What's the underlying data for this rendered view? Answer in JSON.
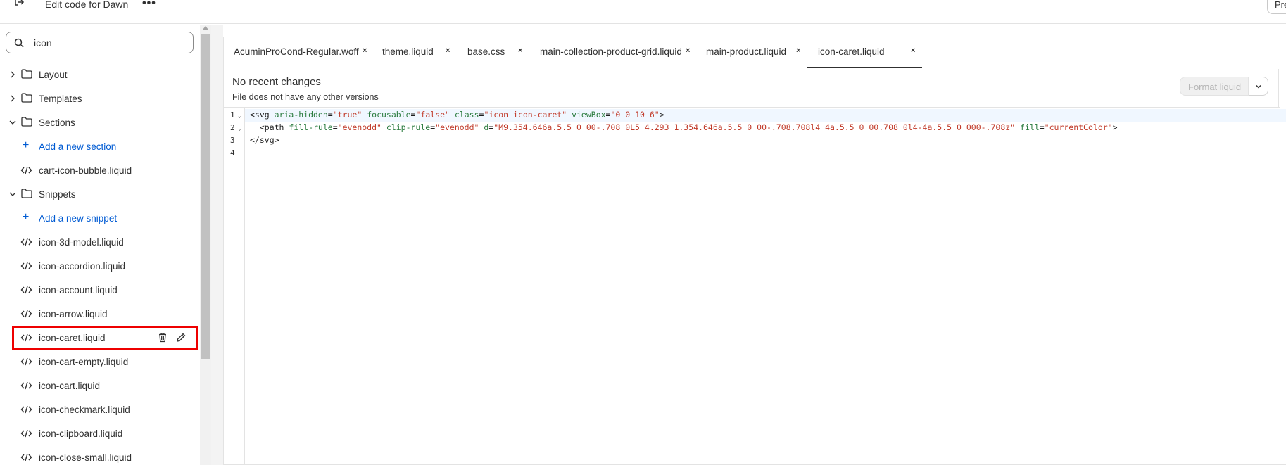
{
  "topbar": {
    "title": "Edit code for Dawn",
    "more_label": "•••",
    "preview_label": "Preview"
  },
  "sidebar": {
    "search_value": "icon",
    "items": [
      {
        "type": "folder",
        "label": "Layout",
        "expanded": false
      },
      {
        "type": "folder",
        "label": "Templates",
        "expanded": false
      },
      {
        "type": "folder",
        "label": "Sections",
        "expanded": true
      },
      {
        "type": "add",
        "label": "Add a new section"
      },
      {
        "type": "file",
        "label": "cart-icon-bubble.liquid"
      },
      {
        "type": "folder",
        "label": "Snippets",
        "expanded": true
      },
      {
        "type": "add",
        "label": "Add a new snippet"
      },
      {
        "type": "file",
        "label": "icon-3d-model.liquid"
      },
      {
        "type": "file",
        "label": "icon-accordion.liquid"
      },
      {
        "type": "file",
        "label": "icon-account.liquid"
      },
      {
        "type": "file",
        "label": "icon-arrow.liquid"
      },
      {
        "type": "file",
        "label": "icon-caret.liquid",
        "selected": true
      },
      {
        "type": "file",
        "label": "icon-cart-empty.liquid"
      },
      {
        "type": "file",
        "label": "icon-cart.liquid"
      },
      {
        "type": "file",
        "label": "icon-checkmark.liquid"
      },
      {
        "type": "file",
        "label": "icon-clipboard.liquid"
      },
      {
        "type": "file",
        "label": "icon-close-small.liquid"
      }
    ]
  },
  "tabs": [
    {
      "label": "AcuminProCond-Regular.woff",
      "close": "×"
    },
    {
      "label": "theme.liquid",
      "close": "×"
    },
    {
      "label": "base.css",
      "close": "×"
    },
    {
      "label": "main-collection-product-grid.liquid",
      "close": "×"
    },
    {
      "label": "main-product.liquid",
      "close": "×"
    },
    {
      "label": "icon-caret.liquid",
      "close": "×",
      "active": true
    }
  ],
  "info": {
    "heading": "No recent changes",
    "subtext": "File does not have any other versions",
    "format_label": "Format liquid"
  },
  "code": {
    "line_numbers": [
      "1",
      "2",
      "3",
      "4"
    ],
    "lines": [
      [
        {
          "t": "tag",
          "v": "<svg "
        },
        {
          "t": "attr",
          "v": "aria-hidden"
        },
        {
          "t": "tag",
          "v": "="
        },
        {
          "t": "str",
          "v": "\"true\""
        },
        {
          "t": "tag",
          "v": " "
        },
        {
          "t": "attr",
          "v": "focusable"
        },
        {
          "t": "tag",
          "v": "="
        },
        {
          "t": "str",
          "v": "\"false\""
        },
        {
          "t": "tag",
          "v": " "
        },
        {
          "t": "attr",
          "v": "class"
        },
        {
          "t": "tag",
          "v": "="
        },
        {
          "t": "str",
          "v": "\"icon icon-caret\""
        },
        {
          "t": "tag",
          "v": " "
        },
        {
          "t": "attr",
          "v": "viewBox"
        },
        {
          "t": "tag",
          "v": "="
        },
        {
          "t": "str",
          "v": "\"0 0 10 6\""
        },
        {
          "t": "tag",
          "v": ">"
        }
      ],
      [
        {
          "t": "tag",
          "v": "  <path "
        },
        {
          "t": "attr",
          "v": "fill-rule"
        },
        {
          "t": "tag",
          "v": "="
        },
        {
          "t": "str",
          "v": "\"evenodd\""
        },
        {
          "t": "tag",
          "v": " "
        },
        {
          "t": "attr",
          "v": "clip-rule"
        },
        {
          "t": "tag",
          "v": "="
        },
        {
          "t": "str",
          "v": "\"evenodd\""
        },
        {
          "t": "tag",
          "v": " "
        },
        {
          "t": "attr",
          "v": "d"
        },
        {
          "t": "tag",
          "v": "="
        },
        {
          "t": "str",
          "v": "\"M9.354.646a.5.5 0 00-.708 0L5 4.293 1.354.646a.5.5 0 00-.708.708l4 4a.5.5 0 00.708 0l4-4a.5.5 0 000-.708z\""
        },
        {
          "t": "tag",
          "v": " "
        },
        {
          "t": "attr",
          "v": "fill"
        },
        {
          "t": "tag",
          "v": "="
        },
        {
          "t": "str",
          "v": "\"currentColor\""
        },
        {
          "t": "tag",
          "v": ">"
        }
      ],
      [
        {
          "t": "tag",
          "v": "</svg>"
        }
      ],
      []
    ]
  },
  "colors": {
    "accent": "#005bd3",
    "highlight": "#ee0000",
    "attr": "#2a7b3e",
    "string": "#c13b2a"
  }
}
